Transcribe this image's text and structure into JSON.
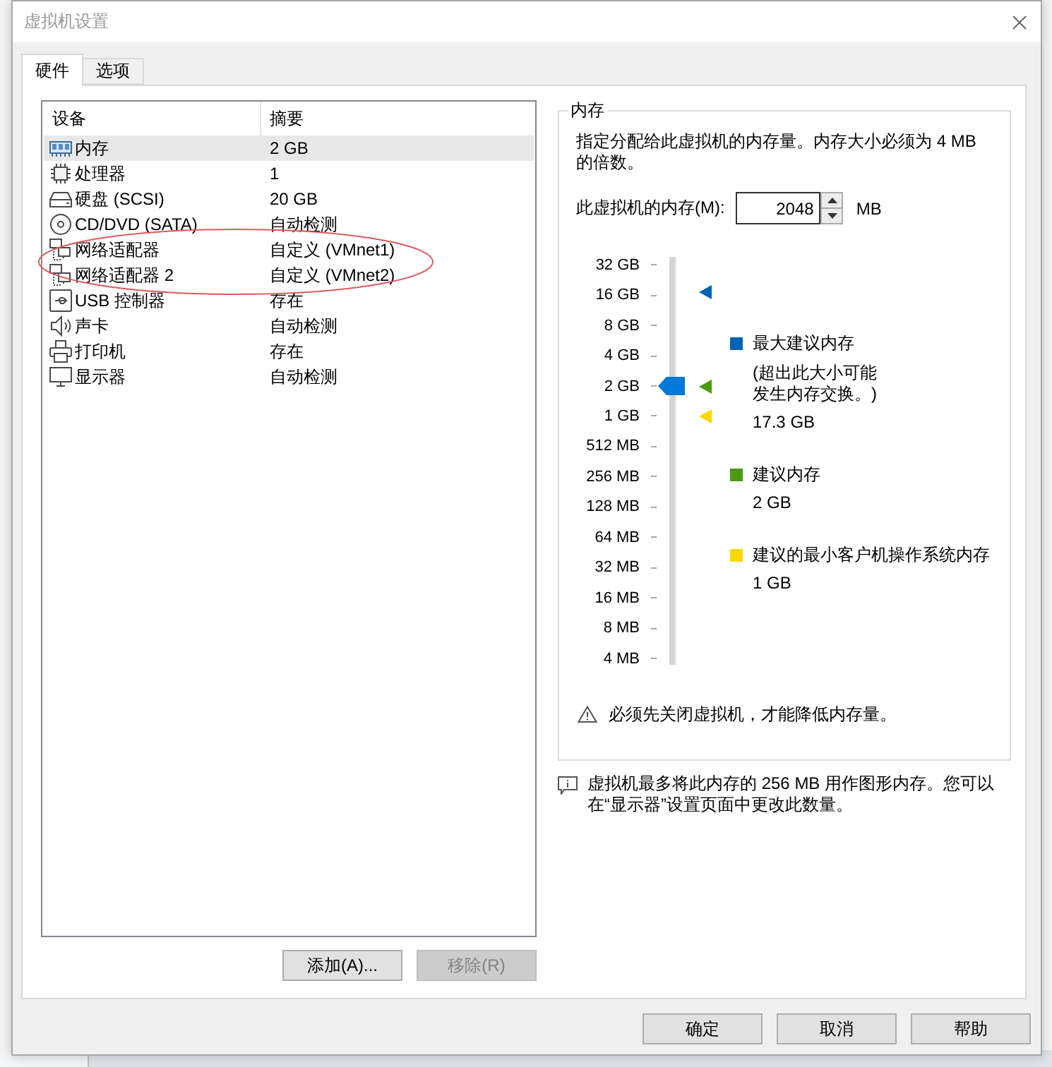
{
  "window": {
    "title": "虚拟机设置"
  },
  "tabs": [
    {
      "label": "硬件",
      "selected": true
    },
    {
      "label": "选项",
      "selected": false
    }
  ],
  "device_table": {
    "columns": [
      "设备",
      "摘要"
    ],
    "rows": [
      {
        "kind": "memory",
        "device": "内存",
        "summary": "2 GB",
        "selected": true,
        "circled": false
      },
      {
        "kind": "processor",
        "device": "处理器",
        "summary": "1",
        "selected": false,
        "circled": false
      },
      {
        "kind": "disk",
        "device": "硬盘 (SCSI)",
        "summary": "20 GB",
        "selected": false,
        "circled": false
      },
      {
        "kind": "cdrom",
        "device": "CD/DVD (SATA)",
        "summary": "自动检测",
        "selected": false,
        "circled": false
      },
      {
        "kind": "network",
        "device": "网络适配器",
        "summary": "自定义 (VMnet1)",
        "selected": false,
        "circled": true
      },
      {
        "kind": "network",
        "device": "网络适配器 2",
        "summary": "自定义 (VMnet2)",
        "selected": false,
        "circled": true
      },
      {
        "kind": "usb",
        "device": "USB 控制器",
        "summary": "存在",
        "selected": false,
        "circled": false
      },
      {
        "kind": "sound",
        "device": "声卡",
        "summary": "自动检测",
        "selected": false,
        "circled": false
      },
      {
        "kind": "printer",
        "device": "打印机",
        "summary": "存在",
        "selected": false,
        "circled": false
      },
      {
        "kind": "display",
        "device": "显示器",
        "summary": "自动检测",
        "selected": false,
        "circled": false
      }
    ]
  },
  "device_buttons": [
    {
      "label": "添加(A)...",
      "disabled": false
    },
    {
      "label": "移除(R)",
      "disabled": true
    }
  ],
  "memory_group": {
    "title": "内存",
    "description": "指定分配给此虚拟机的内存量。内存大小必须为 4 MB 的倍数。",
    "memory_field": {
      "label": "此虚拟机的内存(M):",
      "value": "2048",
      "unit": "MB"
    },
    "slider": {
      "ticks": [
        "32 GB",
        "16 GB",
        "8 GB",
        "4 GB",
        "2 GB",
        "1 GB",
        "512 MB",
        "256 MB",
        "128 MB",
        "64 MB",
        "32 MB",
        "16 MB",
        "8 MB",
        "4 MB"
      ],
      "level": 0.6923,
      "markers": [
        {
          "color": "#0063b1",
          "level": 0.9315
        },
        {
          "color": "#4a9a0e",
          "level": 0.6923
        },
        {
          "color": "#fcd800",
          "level": 0.6154
        }
      ]
    },
    "legend": [
      {
        "color": "#0063b1",
        "label": "最大建议内存",
        "note": "(超出此大小可能发生内存交换。)",
        "value": "17.3 GB"
      },
      {
        "color": "#4a9a0e",
        "label": "建议内存",
        "value": "2 GB"
      },
      {
        "color": "#fcd800",
        "label": "建议的最小客户机操作系统内存",
        "value": "1 GB"
      }
    ],
    "warning": "必须先关闭虚拟机，才能降低内存量。"
  },
  "graphics_note": "虚拟机最多将此内存的 256 MB 用作图形内存。您可以在“显示器”设置页面中更改此数量。",
  "dialog_buttons": [
    "确定",
    "取消",
    "帮助"
  ]
}
